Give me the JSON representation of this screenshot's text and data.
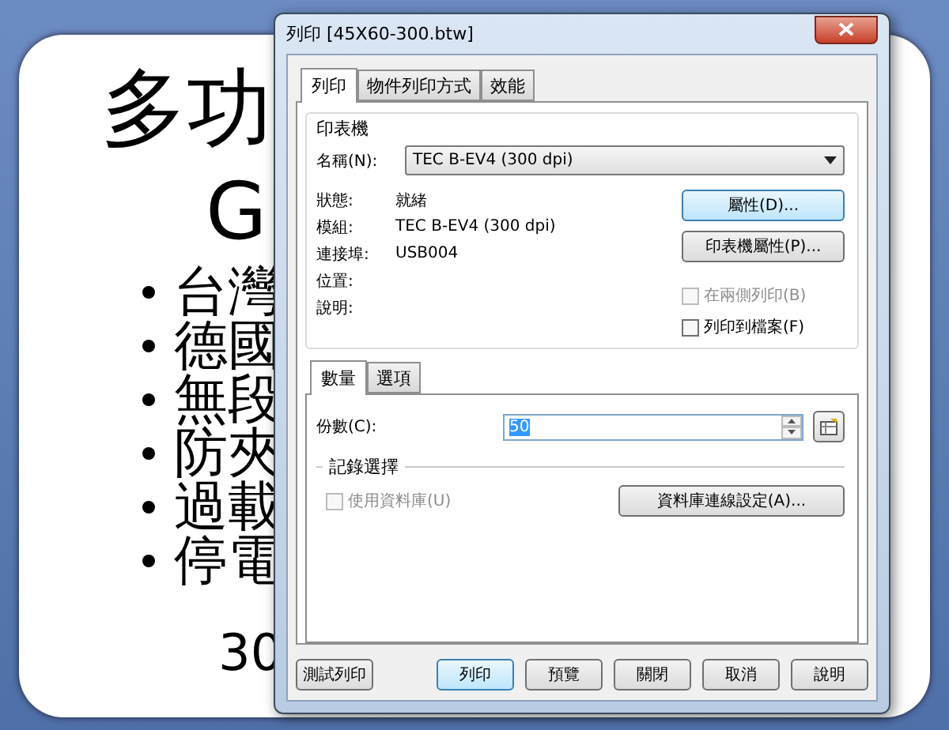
{
  "slide": {
    "title": "多功",
    "subtitle": "G",
    "bullets": [
      "台灣",
      "德國",
      "無段",
      "防夾",
      "過載",
      "停電"
    ],
    "footer": "30"
  },
  "dialog": {
    "title": "列印 [45X60-300.btw]",
    "tabs": [
      {
        "label": "列印",
        "selected": true
      },
      {
        "label": "物件列印方式",
        "selected": false
      },
      {
        "label": "效能",
        "selected": false
      }
    ],
    "printer": {
      "label": "印表機",
      "name_label": "名稱(N):",
      "name_value": "TEC B-EV4 (300 dpi)",
      "info": [
        {
          "label": "狀態:",
          "value": "就緒"
        },
        {
          "label": "模組:",
          "value": "TEC B-EV4 (300 dpi)"
        },
        {
          "label": "連接埠:",
          "value": "USB004"
        },
        {
          "label": "位置:"
        },
        {
          "label": "說明:"
        }
      ],
      "buttons": [
        {
          "label": "屬性(D)...",
          "focused": true
        },
        {
          "label": "印表機屬性(P)...",
          "focused": false
        }
      ],
      "checkboxes": [
        {
          "label": "在兩側列印(B)",
          "checked": false,
          "disabled": true
        },
        {
          "label": "列印到檔案(F)",
          "checked": false,
          "disabled": false
        }
      ]
    },
    "sub_tabs": [
      {
        "label": "數量",
        "selected": true
      },
      {
        "label": "選項",
        "selected": false
      }
    ],
    "copies": {
      "label": "份數(C):",
      "value": "50"
    },
    "records": {
      "label": "記錄選擇",
      "checkbox": {
        "label": "使用資料庫(U)",
        "checked": false,
        "disabled": true
      },
      "button": "資料庫連線設定(A)..."
    },
    "buttons": [
      {
        "label": "測試列印",
        "default": false
      },
      {
        "label": "列印",
        "default": true
      },
      {
        "label": "預覽",
        "default": false
      },
      {
        "label": "關閉",
        "default": false
      },
      {
        "label": "取消",
        "default": false
      },
      {
        "label": "說明",
        "default": false
      }
    ]
  }
}
